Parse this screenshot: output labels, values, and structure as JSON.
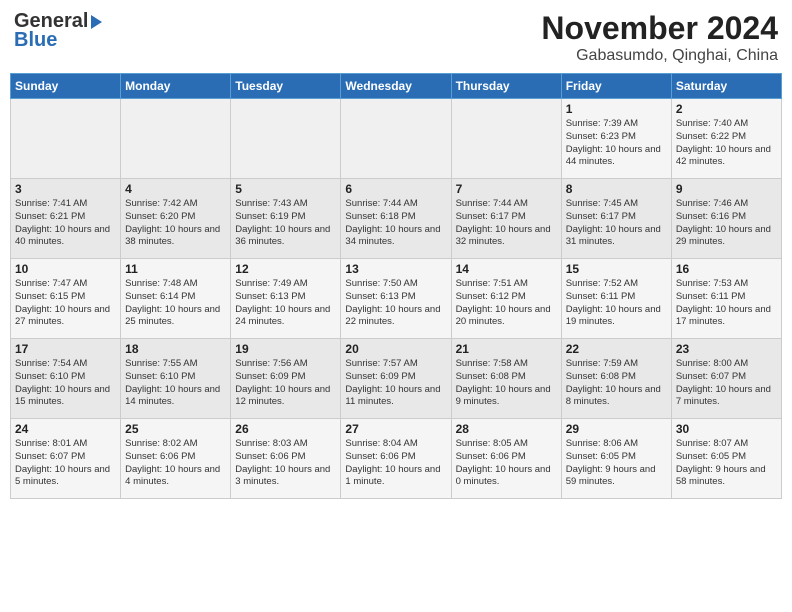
{
  "header": {
    "logo_line1": "General",
    "logo_line2": "Blue",
    "title": "November 2024",
    "subtitle": "Gabasumdo, Qinghai, China"
  },
  "days_of_week": [
    "Sunday",
    "Monday",
    "Tuesday",
    "Wednesday",
    "Thursday",
    "Friday",
    "Saturday"
  ],
  "weeks": [
    [
      {
        "day": "",
        "text": ""
      },
      {
        "day": "",
        "text": ""
      },
      {
        "day": "",
        "text": ""
      },
      {
        "day": "",
        "text": ""
      },
      {
        "day": "",
        "text": ""
      },
      {
        "day": "1",
        "text": "Sunrise: 7:39 AM\nSunset: 6:23 PM\nDaylight: 10 hours and 44 minutes."
      },
      {
        "day": "2",
        "text": "Sunrise: 7:40 AM\nSunset: 6:22 PM\nDaylight: 10 hours and 42 minutes."
      }
    ],
    [
      {
        "day": "3",
        "text": "Sunrise: 7:41 AM\nSunset: 6:21 PM\nDaylight: 10 hours and 40 minutes."
      },
      {
        "day": "4",
        "text": "Sunrise: 7:42 AM\nSunset: 6:20 PM\nDaylight: 10 hours and 38 minutes."
      },
      {
        "day": "5",
        "text": "Sunrise: 7:43 AM\nSunset: 6:19 PM\nDaylight: 10 hours and 36 minutes."
      },
      {
        "day": "6",
        "text": "Sunrise: 7:44 AM\nSunset: 6:18 PM\nDaylight: 10 hours and 34 minutes."
      },
      {
        "day": "7",
        "text": "Sunrise: 7:44 AM\nSunset: 6:17 PM\nDaylight: 10 hours and 32 minutes."
      },
      {
        "day": "8",
        "text": "Sunrise: 7:45 AM\nSunset: 6:17 PM\nDaylight: 10 hours and 31 minutes."
      },
      {
        "day": "9",
        "text": "Sunrise: 7:46 AM\nSunset: 6:16 PM\nDaylight: 10 hours and 29 minutes."
      }
    ],
    [
      {
        "day": "10",
        "text": "Sunrise: 7:47 AM\nSunset: 6:15 PM\nDaylight: 10 hours and 27 minutes."
      },
      {
        "day": "11",
        "text": "Sunrise: 7:48 AM\nSunset: 6:14 PM\nDaylight: 10 hours and 25 minutes."
      },
      {
        "day": "12",
        "text": "Sunrise: 7:49 AM\nSunset: 6:13 PM\nDaylight: 10 hours and 24 minutes."
      },
      {
        "day": "13",
        "text": "Sunrise: 7:50 AM\nSunset: 6:13 PM\nDaylight: 10 hours and 22 minutes."
      },
      {
        "day": "14",
        "text": "Sunrise: 7:51 AM\nSunset: 6:12 PM\nDaylight: 10 hours and 20 minutes."
      },
      {
        "day": "15",
        "text": "Sunrise: 7:52 AM\nSunset: 6:11 PM\nDaylight: 10 hours and 19 minutes."
      },
      {
        "day": "16",
        "text": "Sunrise: 7:53 AM\nSunset: 6:11 PM\nDaylight: 10 hours and 17 minutes."
      }
    ],
    [
      {
        "day": "17",
        "text": "Sunrise: 7:54 AM\nSunset: 6:10 PM\nDaylight: 10 hours and 15 minutes."
      },
      {
        "day": "18",
        "text": "Sunrise: 7:55 AM\nSunset: 6:10 PM\nDaylight: 10 hours and 14 minutes."
      },
      {
        "day": "19",
        "text": "Sunrise: 7:56 AM\nSunset: 6:09 PM\nDaylight: 10 hours and 12 minutes."
      },
      {
        "day": "20",
        "text": "Sunrise: 7:57 AM\nSunset: 6:09 PM\nDaylight: 10 hours and 11 minutes."
      },
      {
        "day": "21",
        "text": "Sunrise: 7:58 AM\nSunset: 6:08 PM\nDaylight: 10 hours and 9 minutes."
      },
      {
        "day": "22",
        "text": "Sunrise: 7:59 AM\nSunset: 6:08 PM\nDaylight: 10 hours and 8 minutes."
      },
      {
        "day": "23",
        "text": "Sunrise: 8:00 AM\nSunset: 6:07 PM\nDaylight: 10 hours and 7 minutes."
      }
    ],
    [
      {
        "day": "24",
        "text": "Sunrise: 8:01 AM\nSunset: 6:07 PM\nDaylight: 10 hours and 5 minutes."
      },
      {
        "day": "25",
        "text": "Sunrise: 8:02 AM\nSunset: 6:06 PM\nDaylight: 10 hours and 4 minutes."
      },
      {
        "day": "26",
        "text": "Sunrise: 8:03 AM\nSunset: 6:06 PM\nDaylight: 10 hours and 3 minutes."
      },
      {
        "day": "27",
        "text": "Sunrise: 8:04 AM\nSunset: 6:06 PM\nDaylight: 10 hours and 1 minute."
      },
      {
        "day": "28",
        "text": "Sunrise: 8:05 AM\nSunset: 6:06 PM\nDaylight: 10 hours and 0 minutes."
      },
      {
        "day": "29",
        "text": "Sunrise: 8:06 AM\nSunset: 6:05 PM\nDaylight: 9 hours and 59 minutes."
      },
      {
        "day": "30",
        "text": "Sunrise: 8:07 AM\nSunset: 6:05 PM\nDaylight: 9 hours and 58 minutes."
      }
    ]
  ]
}
